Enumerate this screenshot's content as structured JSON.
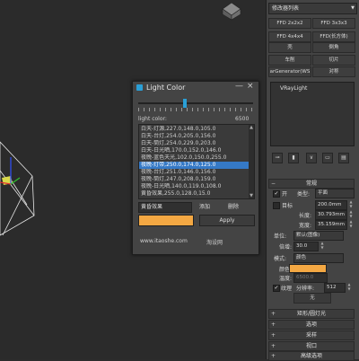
{
  "dialog": {
    "title": "Light Color",
    "minimize": "—",
    "close": "×",
    "slider_level": 0.4,
    "light_color_label": "light color:",
    "light_color_value": "6500",
    "presets": [
      "白天-灯源,227.0,148.0,105.0",
      "白天-台灯,254.0,205.0,156.0",
      "白天-筒灯,254.0,229.0,203.0",
      "白天-日光晒,170.0,152.0,146.0",
      "夜晚-蓝色天光,102.0,150.0,255.0",
      "夜晚-灯带,250.0,174.0,125.0",
      "夜晚-台灯,251.0,146.0,156.0",
      "夜晚-筒灯,247.0,208.0,159.0",
      "夜晚-日光晒,140.0,119.0,108.0",
      "黄昏效果,255.0,128.0,15.0"
    ],
    "selected_index": 5,
    "selected_name": "黄昏效果",
    "add_label": "添加",
    "delete_label": "删除",
    "swatch_color": "#f4a843",
    "apply_label": "Apply",
    "website": "www.itaoshe.com",
    "site_name": "淘设网"
  },
  "panel": {
    "modifier_list": "修改器列表",
    "buttons": [
      "FFD 2x2x2",
      "FFD 3x3x3",
      "FFD 4x4x4",
      "FFD(长方体)",
      "壳",
      "倒角",
      "车削",
      "切片",
      "arGenerator(WS",
      "对称"
    ],
    "stack_item": "VRayLight",
    "rollouts": {
      "params": "常规",
      "rect_light": "矩形/圆灯光",
      "options": "选项",
      "sampling": "采样",
      "viewport": "视口",
      "advanced": "高级选项"
    },
    "on_label": "开",
    "type_label": "类型:",
    "type_value": "平面",
    "target_label": "目标",
    "target_value": "200.0mm",
    "length_label": "长度:",
    "length_value": "30.793mm",
    "width_label": "宽度:",
    "width_value": "35.159mm",
    "units_label": "单位:",
    "units_value": "默认(图像)",
    "multiplier_label": "倍增:",
    "multiplier_value": "30.0",
    "mode_label": "模式:",
    "mode_value": "颜色",
    "color_label": "颜色:",
    "color_value": "#f4a843",
    "temperature_label": "温度:",
    "temperature_value": "6500.0",
    "texture_label": "纹理",
    "resolution_label": "分辨率:",
    "resolution_value": "512",
    "none_label": "无"
  }
}
